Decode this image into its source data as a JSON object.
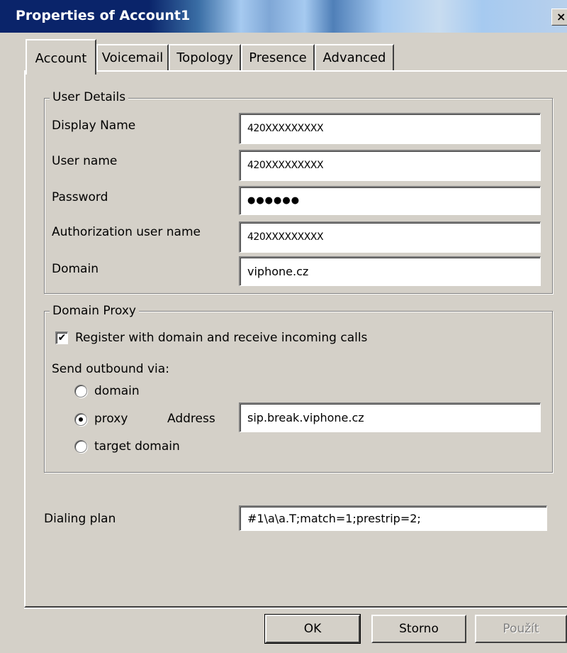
{
  "window": {
    "title": "Properties of Account1",
    "close_glyph": "×"
  },
  "tabs": [
    {
      "label": "Account",
      "active": true
    },
    {
      "label": "Voicemail",
      "active": false
    },
    {
      "label": "Topology",
      "active": false
    },
    {
      "label": "Presence",
      "active": false
    },
    {
      "label": "Advanced",
      "active": false
    }
  ],
  "user_details": {
    "legend": "User Details",
    "display_name_label": "Display Name",
    "display_name_value": "420XXXXXXXXX",
    "user_name_label": "User name",
    "user_name_value": "420XXXXXXXXX",
    "password_label": "Password",
    "password_value": "●●●●●●",
    "auth_user_label": "Authorization user name",
    "auth_user_value": "420XXXXXXXXX",
    "domain_label": "Domain",
    "domain_value": "viphone.cz"
  },
  "domain_proxy": {
    "legend": "Domain Proxy",
    "register_label": "Register with domain and receive incoming calls",
    "register_checked": true,
    "send_outbound_label": "Send outbound via:",
    "options": [
      {
        "label": "domain",
        "selected": false
      },
      {
        "label": "proxy",
        "selected": true
      },
      {
        "label": "target domain",
        "selected": false
      }
    ],
    "address_label": "Address",
    "address_value": "sip.break.viphone.cz"
  },
  "dialing_plan": {
    "label": "Dialing plan",
    "value": "#1\\a\\a.T;match=1;prestrip=2;"
  },
  "buttons": {
    "ok": "OK",
    "cancel": "Storno",
    "apply": "Použít"
  },
  "icons": {
    "checkbox_check": "check-icon",
    "close": "close-icon"
  }
}
